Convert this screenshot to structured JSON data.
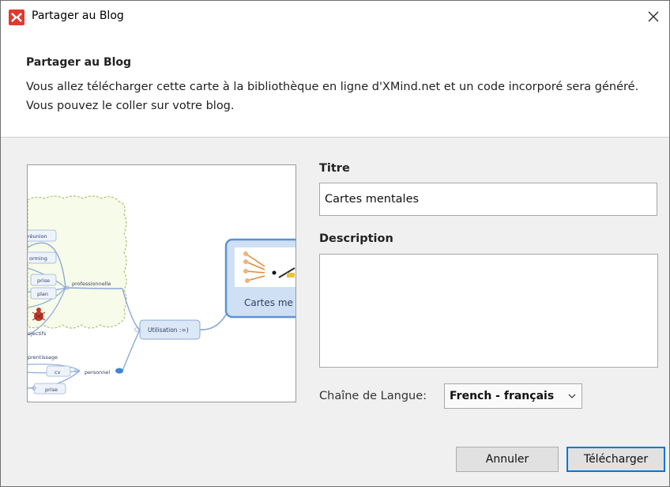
{
  "window": {
    "title": "Partager au Blog",
    "close_glyph": "✕",
    "app_icon": "xmind-logo-icon",
    "accent_color": "#e03a2f"
  },
  "header": {
    "title": "Partager au Blog",
    "description": "Vous allez télécharger cette carte à la bibliothèque en ligne d'XMind.net et un code incorporé sera généré. Vous pouvez le coller sur votre blog."
  },
  "preview": {
    "nodes": {
      "reunion": "réunion",
      "storming": "orming",
      "prise": "prise",
      "plan": "plan",
      "objectifs": "ojectifs",
      "professionnelle": "professionnelle",
      "utilisation": "Utilisation :=)",
      "apprentissage": "prentissage",
      "cv": "cv",
      "personnel": "personnel",
      "prise2": "prise",
      "central": "Cartes me"
    }
  },
  "form": {
    "title_label": "Titre",
    "title_value": "Cartes mentales",
    "description_label": "Description",
    "description_value": "",
    "language_label": "Chaîne de Langue:",
    "language_value": "French - français"
  },
  "buttons": {
    "cancel": "Annuler",
    "upload": "Télécharger"
  }
}
